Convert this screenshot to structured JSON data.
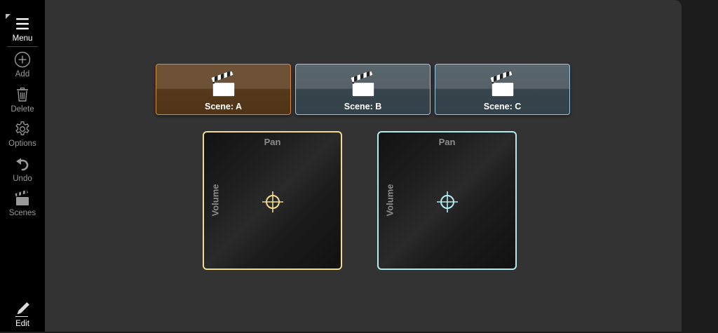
{
  "sidebar": {
    "menu_label": "Menu",
    "add_label": "Add",
    "delete_label": "Delete",
    "options_label": "Options",
    "undo_label": "Undo",
    "scenes_label": "Scenes",
    "edit_label": "Edit"
  },
  "scenes": [
    {
      "label": "Scene: A",
      "active": true
    },
    {
      "label": "Scene: B",
      "active": false
    },
    {
      "label": "Scene: C",
      "active": false
    }
  ],
  "pads": [
    {
      "x_label": "Pan",
      "y_label": "Volume",
      "color": "#f2dc8c"
    },
    {
      "x_label": "Pan",
      "y_label": "Volume",
      "color": "#b2ecf0"
    }
  ],
  "colors": {
    "active_scene": "#d98a3a",
    "inactive_scene": "#97c6e6",
    "canvas": "#333333",
    "sidebar": "#000000"
  },
  "icons": {
    "menu": "hamburger-icon",
    "add": "plus-circle-icon",
    "delete": "trash-icon",
    "options": "gear-icon",
    "undo": "undo-icon",
    "scenes": "clapperboard-icon",
    "edit": "pencil-icon"
  }
}
